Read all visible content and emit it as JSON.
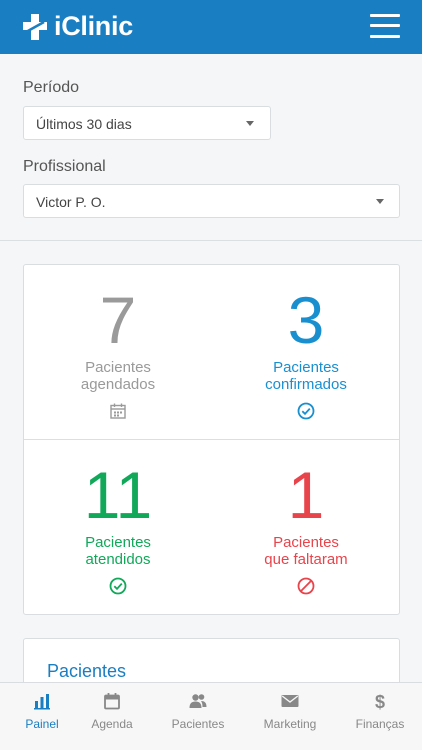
{
  "header": {
    "brand": "iClinic",
    "menu_icon": "hamburger-menu-icon"
  },
  "filters": {
    "period_label": "Período",
    "period_value": "Últimos 30 dias",
    "professional_label": "Profissional",
    "professional_value": "Victor P. O."
  },
  "stats": {
    "scheduled": {
      "number": "7",
      "line1": "Pacientes",
      "line2": "agendados",
      "icon": "calendar-icon",
      "color": "#999999"
    },
    "confirmed": {
      "number": "3",
      "line1": "Pacientes",
      "line2": "confirmados",
      "icon": "check-circle-icon",
      "color": "#1a8fd0"
    },
    "attended": {
      "number": "11",
      "line1": "Pacientes",
      "line2": "atendidos",
      "icon": "check-circle-icon",
      "color": "#12a85a"
    },
    "missed": {
      "number": "1",
      "line1": "Pacientes",
      "line2": "que faltaram",
      "icon": "ban-icon",
      "color": "#e8444b"
    }
  },
  "patients_section": {
    "title": "Pacientes"
  },
  "bottom_nav": [
    {
      "label": "Painel",
      "icon": "bar-chart-icon",
      "active": true
    },
    {
      "label": "Agenda",
      "icon": "calendar-icon",
      "active": false
    },
    {
      "label": "Pacientes",
      "icon": "users-icon",
      "active": false
    },
    {
      "label": "Marketing",
      "icon": "envelope-icon",
      "active": false
    },
    {
      "label": "Finanças",
      "icon": "dollar-icon",
      "active": false
    }
  ],
  "colors": {
    "brand": "#1a7ec2",
    "active_nav": "#1a7ec2"
  }
}
